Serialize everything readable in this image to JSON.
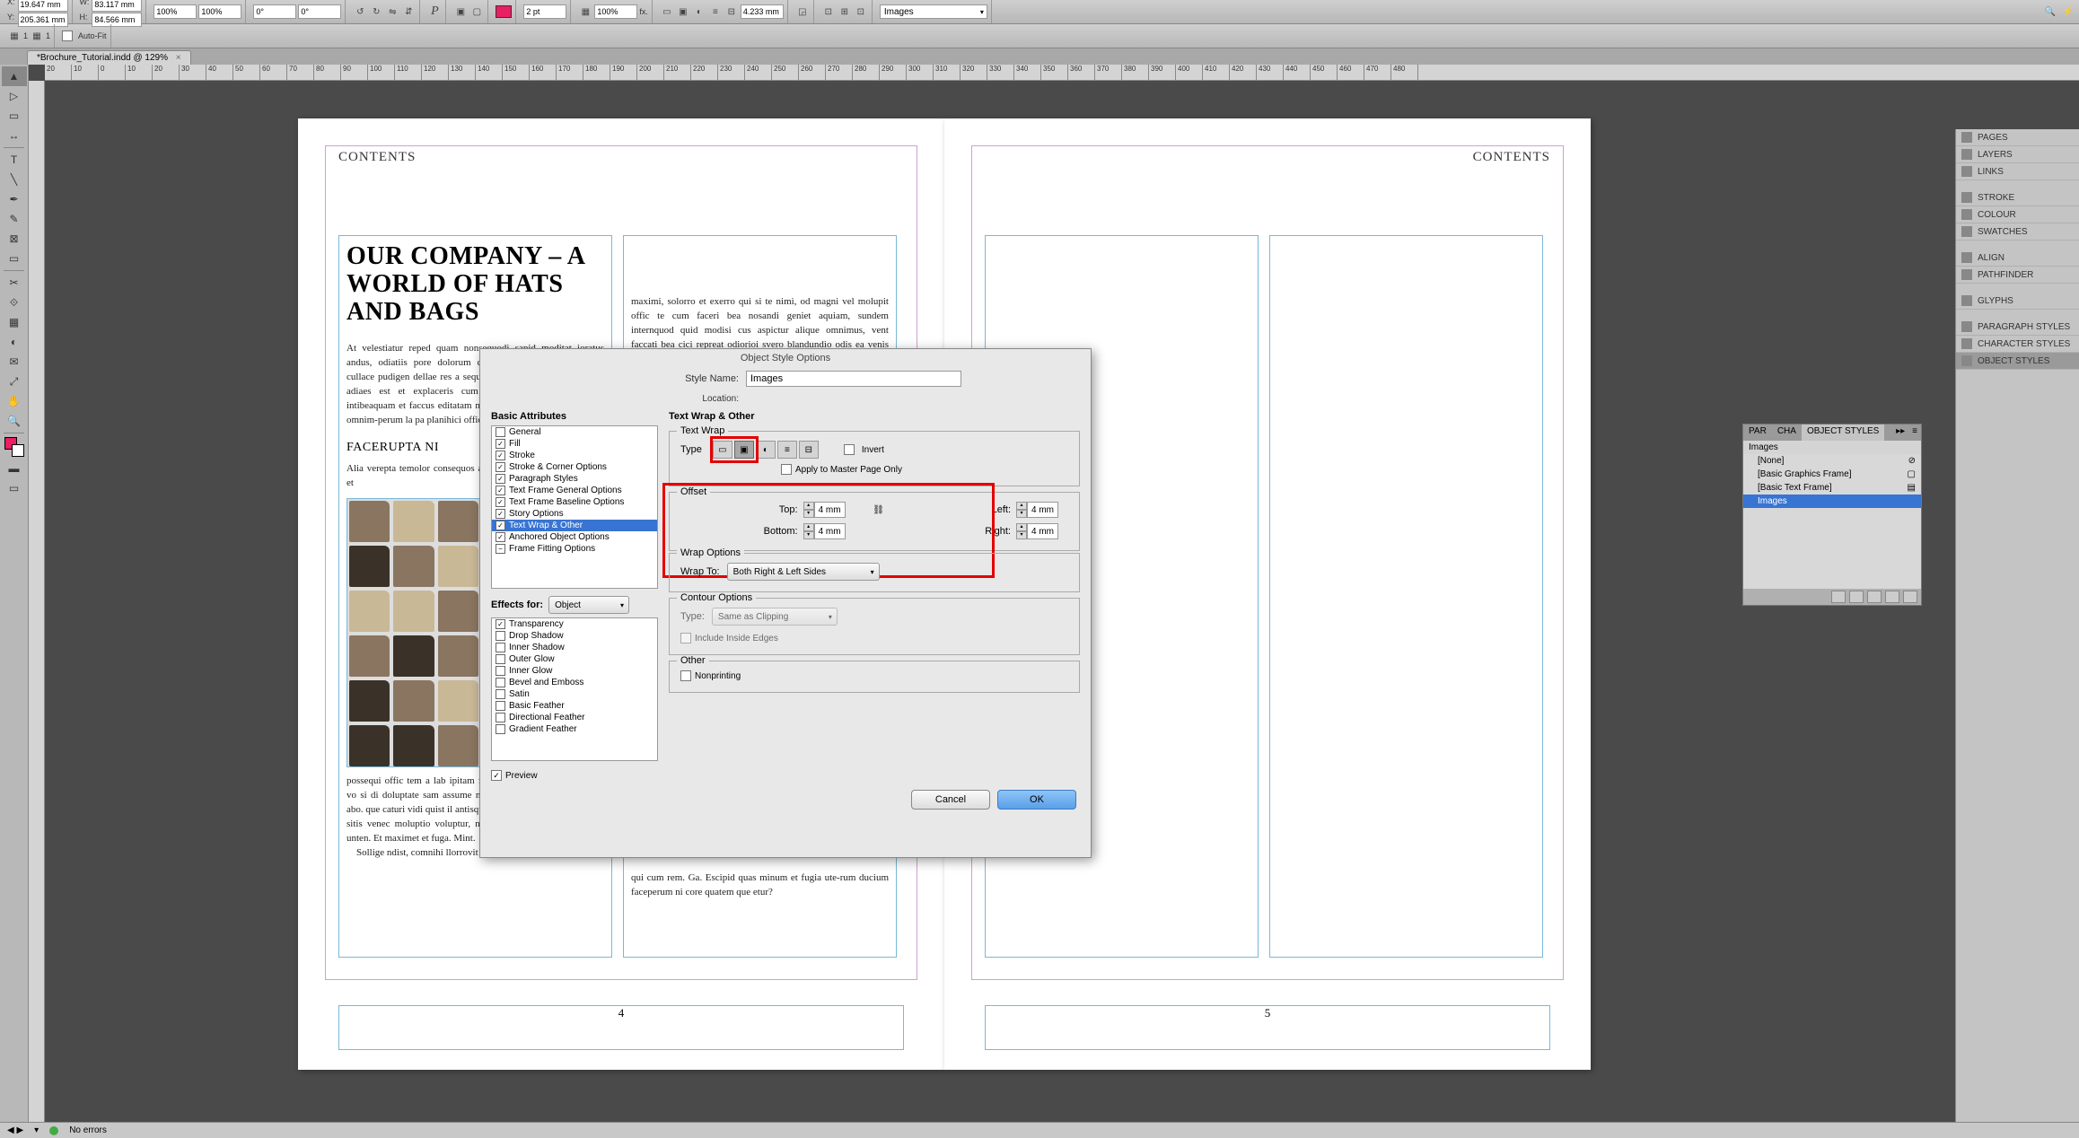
{
  "controlbar": {
    "x_label": "X:",
    "x_value": "19.647 mm",
    "y_label": "Y:",
    "y_value": "205.361 mm",
    "w_label": "W:",
    "w_value": "83.117 mm",
    "h_label": "H:",
    "h_value": "84.566 mm",
    "scale_x": "100%",
    "scale_y": "100%",
    "rotate": "0°",
    "shear": "0°",
    "stroke_weight": "2 pt",
    "opacity": "100%",
    "fx_label": "fx.",
    "wrap_offset": "4.233 mm",
    "autofit_label": "Auto-Fit",
    "style_dropdown": "Images"
  },
  "tab": {
    "title": "*Brochure_Tutorial.indd @ 129%"
  },
  "ruler_marks": [
    "20",
    "10",
    "0",
    "10",
    "20",
    "30",
    "40",
    "50",
    "60",
    "70",
    "80",
    "90",
    "100",
    "110",
    "120",
    "130",
    "140",
    "150",
    "160",
    "170",
    "180",
    "190",
    "200",
    "210",
    "220",
    "230",
    "240",
    "250",
    "260",
    "270",
    "280",
    "290",
    "300",
    "310",
    "320",
    "330",
    "340",
    "350",
    "360",
    "370",
    "380",
    "390",
    "400",
    "410",
    "420",
    "430",
    "440",
    "450",
    "460",
    "470",
    "480"
  ],
  "page_left": {
    "heading": "CONTENTS",
    "title": "OUR COMPANY – A WORLD OF HATS AND BAGS",
    "para1": "At velestiatur reped quam nonsequodi sapid moditat ioratus andus, odiatiis pore dolorum quatem quia dit utemquaecae cullace pudigen dellae res a sequid quosa quaesti odita est rerit adiaes est et explaceris cum voluptat ut haricionem ab intibeaquam et faccus editatam nam dolendi rero ducimus eum, omnim-perum la pa planihici offic te quia nos dollupat.",
    "subhead": "FACERUPTA NI",
    "para2": "Alia verepta temolor consequos aut as ipien simin restibus aute et",
    "para3": "possequi offic tem a lab ipitam fugiandem tibus, quasperit, aut vo si di doluptate sam assume ndebitiorum la que reped expla abo. que caturi vidi quist il antisquas niber volorerio maximagnis sitis venec moluptio voluptur, nos dendior erspedironem essit unten. Et maximet et fuga. Mint.",
    "para4": "Sollige ndist, comnihi llorrovit ma doluptatis",
    "col2_text": "maximi, solorro et exerro qui si te nimi, od magni vel molupit offic te cum faceri bea nosandi geniet aquiam, sundem internquod quid modisi cus aspictur alique omnimus, vent faccati bea cici repreat odiorioi svero blandundio odis ea venis remos doluptatur, ut eum reperia in corecti berum, sant et esse quia veli-qui occus ducim alibus et ut velit optur, quamus, ut este et esto ipit lacerio nesto berae. Tur, iusam ni-",
    "col2_text2": "qui cum rem. Ga. Escipid quas minum et fugia ute-rum ducium faceperum ni core quatem que etur?",
    "page_num": "4"
  },
  "page_right": {
    "heading": "CONTENTS",
    "page_num": "5"
  },
  "dialog": {
    "title": "Object Style Options",
    "style_name_label": "Style Name:",
    "style_name_value": "Images",
    "location_label": "Location:",
    "basic_attributes_label": "Basic Attributes",
    "attributes": [
      {
        "label": "General",
        "checked": false
      },
      {
        "label": "Fill",
        "checked": true
      },
      {
        "label": "Stroke",
        "checked": true
      },
      {
        "label": "Stroke & Corner Options",
        "checked": true
      },
      {
        "label": "Paragraph Styles",
        "checked": true
      },
      {
        "label": "Text Frame General Options",
        "checked": true
      },
      {
        "label": "Text Frame Baseline Options",
        "checked": true
      },
      {
        "label": "Story Options",
        "checked": true
      },
      {
        "label": "Text Wrap & Other",
        "checked": true
      },
      {
        "label": "Anchored Object Options",
        "checked": true
      },
      {
        "label": "Frame Fitting Options",
        "checked": "partial"
      }
    ],
    "effects_for_label": "Effects for:",
    "effects_for_value": "Object",
    "effects": [
      {
        "label": "Transparency",
        "checked": true
      },
      {
        "label": "Drop Shadow",
        "checked": false
      },
      {
        "label": "Inner Shadow",
        "checked": false
      },
      {
        "label": "Outer Glow",
        "checked": false
      },
      {
        "label": "Inner Glow",
        "checked": false
      },
      {
        "label": "Bevel and Emboss",
        "checked": false
      },
      {
        "label": "Satin",
        "checked": false
      },
      {
        "label": "Basic Feather",
        "checked": false
      },
      {
        "label": "Directional Feather",
        "checked": false
      },
      {
        "label": "Gradient Feather",
        "checked": false
      }
    ],
    "preview_label": "Preview",
    "section_title": "Text Wrap & Other",
    "text_wrap_label": "Text Wrap",
    "type_label": "Type",
    "invert_label": "Invert",
    "apply_master_label": "Apply to Master Page Only",
    "offset_label": "Offset",
    "offset_top_label": "Top:",
    "offset_top": "4 mm",
    "offset_bottom_label": "Bottom:",
    "offset_bottom": "4 mm",
    "offset_left_label": "Left:",
    "offset_left": "4 mm",
    "offset_right_label": "Right:",
    "offset_right": "4 mm",
    "wrap_options_label": "Wrap Options",
    "wrap_to_label": "Wrap To:",
    "wrap_to_value": "Both Right & Left Sides",
    "contour_label": "Contour Options",
    "contour_type_label": "Type:",
    "contour_type_value": "Same as Clipping",
    "include_inside_label": "Include Inside Edges",
    "other_label": "Other",
    "nonprinting_label": "Nonprinting",
    "cancel_label": "Cancel",
    "ok_label": "OK"
  },
  "object_styles_panel": {
    "tabs": [
      "PAR",
      "CHA",
      "OBJECT STYLES"
    ],
    "header": "Images",
    "items": [
      "[None]",
      "[Basic Graphics Frame]",
      "[Basic Text Frame]",
      "Images"
    ]
  },
  "right_panels": {
    "items": [
      "PAGES",
      "LAYERS",
      "LINKS",
      "STROKE",
      "COLOUR",
      "SWATCHES",
      "ALIGN",
      "PATHFINDER",
      "GLYPHS",
      "PARAGRAPH STYLES",
      "CHARACTER STYLES",
      "OBJECT STYLES"
    ]
  },
  "statusbar": {
    "zoom": "",
    "errors": "No errors"
  }
}
